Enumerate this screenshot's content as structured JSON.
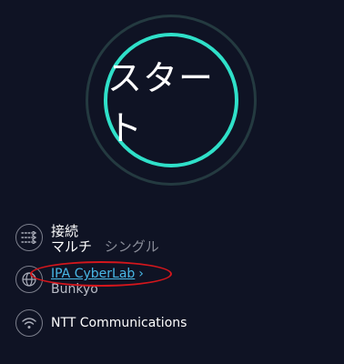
{
  "start_button": {
    "label": "スタート"
  },
  "connection": {
    "label": "接続",
    "options": [
      "マルチ",
      "シングル"
    ],
    "selected": "マルチ",
    "icon": "connections-icon"
  },
  "server": {
    "name": "IPA CyberLab",
    "chevron": "›",
    "location": "Bunkyo",
    "icon": "globe-icon"
  },
  "isp": {
    "name": "NTT Communications",
    "icon": "wifi-icon"
  },
  "colors": {
    "background": "#0f1324",
    "accent_ring": "#2fe0c9",
    "link": "#49b8e6",
    "annotation": "#d4161c"
  }
}
